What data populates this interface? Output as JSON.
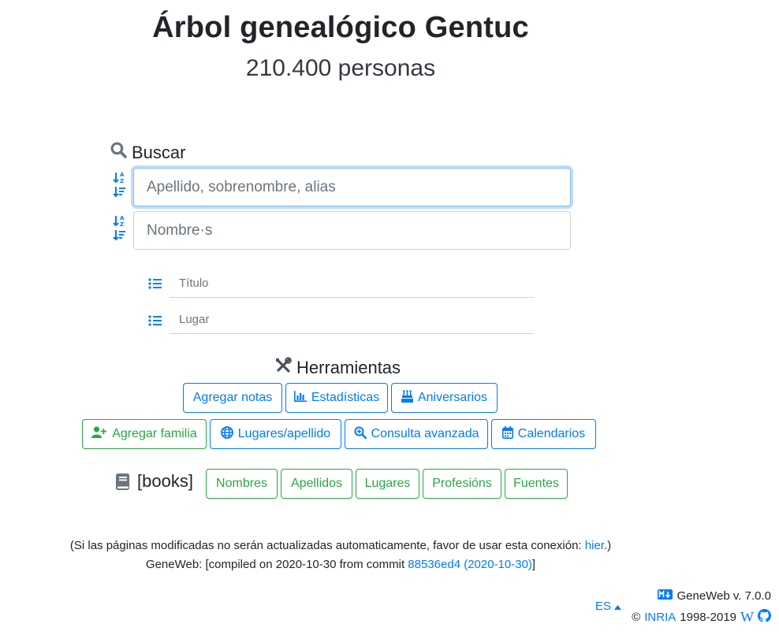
{
  "header": {
    "title": "Árbol genealógico Gentuc",
    "count": "210.400 personas"
  },
  "search": {
    "heading": "Buscar",
    "surname_placeholder": "Apellido, sobrenombre, alias",
    "firstname_placeholder": "Nombre·s",
    "title_placeholder": "Título",
    "place_placeholder": "Lugar"
  },
  "tools": {
    "heading": "Herramientas",
    "row1": [
      "Agregar notas",
      "Estadísticas",
      "Aniversarios"
    ],
    "row2": [
      "Agregar familia",
      "Lugares/apellido",
      "Consulta avanzada",
      "Calendarios"
    ]
  },
  "books": {
    "label": "[books]",
    "items": [
      "Nombres",
      "Apellidos",
      "Lugares",
      "Profesións",
      "Fuentes"
    ]
  },
  "footer": {
    "note_prefix": "(Si las páginas modificadas no serán actualizadas automaticamente, favor de usar esta conexión: ",
    "note_link": "hier",
    "note_suffix": ".)",
    "build_prefix": "GeneWeb: [compiled on 2020-10-30 from commit ",
    "build_link": "88536ed4 (2020-10-30)",
    "build_suffix": "]"
  },
  "corner": {
    "lang": "ES",
    "version": "GeneWeb v. 7.0.0",
    "copyright_prefix": "©",
    "org": "INRIA",
    "years": "1998-2019",
    "wiki_letter": "W"
  },
  "colors": {
    "primary": "#007bff",
    "success": "#28a745",
    "text": "#212529",
    "icon_gray": "#6c757d"
  }
}
